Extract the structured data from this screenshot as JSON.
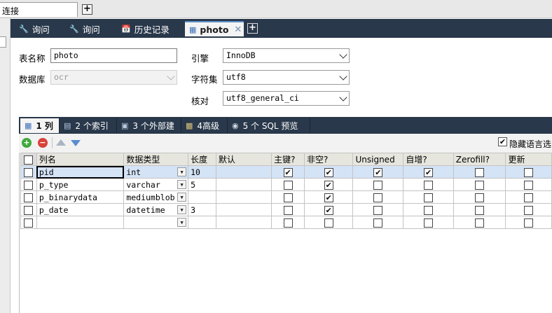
{
  "window": {
    "connection_tab": "连接"
  },
  "tabs": [
    {
      "label": "询问",
      "icon": "query-icon"
    },
    {
      "label": "询问",
      "icon": "query-icon"
    },
    {
      "label": "历史记录",
      "icon": "history-icon"
    },
    {
      "label": "photo",
      "icon": "table-icon",
      "active": true,
      "close": "✕"
    }
  ],
  "form": {
    "table_name_label": "表名称",
    "table_name_value": "photo",
    "database_label": "数据库",
    "database_value": "ocr",
    "engine_label": "引擎",
    "engine_value": "InnoDB",
    "charset_label": "字符集",
    "charset_value": "utf8",
    "collation_label": "核对",
    "collation_value": "utf8_general_ci"
  },
  "subtabs": [
    {
      "label": "1 列",
      "icon": "columns-icon",
      "active": true
    },
    {
      "label": "2 个索引",
      "icon": "index-icon"
    },
    {
      "label": "3 个外部建",
      "icon": "foreign-key-icon"
    },
    {
      "label": "4高级",
      "icon": "advanced-icon"
    },
    {
      "label": "5 个 SQL 预览",
      "icon": "sql-preview-icon"
    }
  ],
  "toolbar": {
    "hide_language_types_label": "隐藏语言选",
    "hide_language_types_checked": true
  },
  "grid": {
    "headers": [
      "列名",
      "数据类型",
      "长度",
      "默认",
      "主键?",
      "非空?",
      "Unsigned",
      "自增?",
      "Zerofill?",
      "更新"
    ],
    "rows": [
      {
        "name": "pid",
        "type": "int",
        "length": "10",
        "default": "",
        "pk": true,
        "notnull": true,
        "unsigned": true,
        "autoinc": true,
        "zerofill": false,
        "update": false,
        "selected": true
      },
      {
        "name": "p_type",
        "type": "varchar",
        "length": "5",
        "default": "",
        "pk": false,
        "notnull": true,
        "unsigned": false,
        "autoinc": false,
        "zerofill": false,
        "update": false
      },
      {
        "name": "p_binarydata",
        "type": "mediumblob",
        "length": "",
        "default": "",
        "pk": false,
        "notnull": true,
        "unsigned": false,
        "autoinc": false,
        "zerofill": false,
        "update": false
      },
      {
        "name": "p_date",
        "type": "datetime",
        "length": "3",
        "default": "",
        "pk": false,
        "notnull": true,
        "unsigned": false,
        "autoinc": false,
        "zerofill": false,
        "update": false
      },
      {
        "name": "",
        "type": "",
        "length": "",
        "default": "",
        "pk": false,
        "notnull": false,
        "unsigned": false,
        "autoinc": false,
        "zerofill": false,
        "update": false
      }
    ]
  },
  "colors": {
    "tab_bar": "#29384b",
    "selected_row": "#d4e3f6",
    "header_bg": "#e7e6de"
  }
}
